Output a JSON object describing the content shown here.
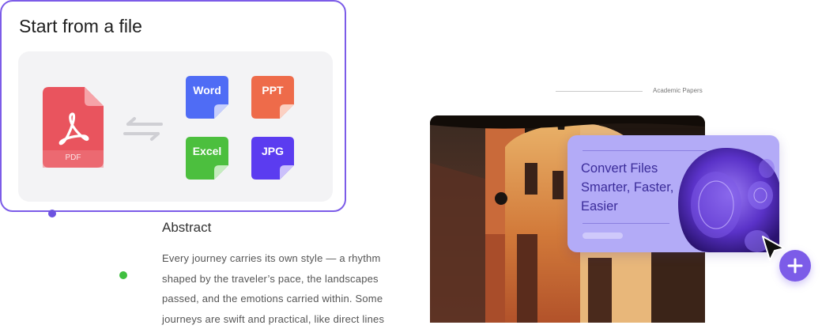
{
  "file_card": {
    "title": "Start from a file",
    "source": {
      "label": "PDF",
      "icon": "pdf-file-icon",
      "color": "#e9545e"
    },
    "swap_icon": "swap-arrows-icon",
    "formats": [
      {
        "label": "Word",
        "color": "#4f6cf5"
      },
      {
        "label": "PPT",
        "color": "#ee6b4a"
      },
      {
        "label": "Excel",
        "color": "#4cbf3e"
      },
      {
        "label": "JPG",
        "color": "#5b3cf0"
      }
    ]
  },
  "abstract": {
    "title": "Abstract",
    "lines": [
      "Every journey carries its own style — a rhythm",
      "shaped by the traveler’s pace, the landscapes",
      "passed, and the emotions carried within. Some",
      "journeys are swift and practical, like direct lines"
    ]
  },
  "section": {
    "caption": "Academic Papers"
  },
  "convert_card": {
    "lines": [
      "Convert Files",
      "Smarter, Faster,",
      "Easier"
    ]
  },
  "colors": {
    "accent": "#7c5ce8",
    "green_dot": "#3fbf3f",
    "card_bg": "#b3abf7",
    "card_text": "#3b2c9a"
  }
}
